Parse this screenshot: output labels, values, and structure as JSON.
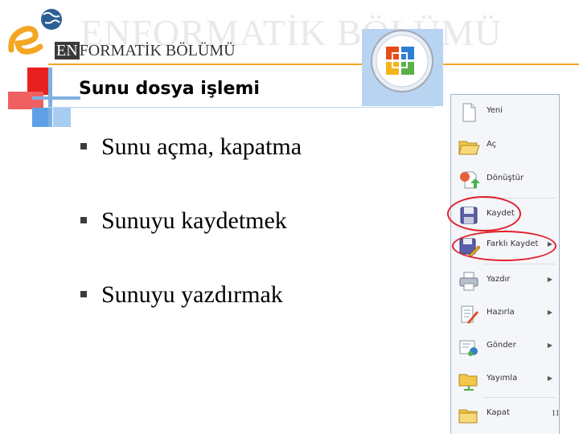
{
  "header": {
    "watermark": "ENFORMATİK BÖLÜMÜ",
    "brand_prefix": "EN",
    "brand_rest": "FORMATİK BÖLÜMÜ"
  },
  "slide": {
    "title": "Sunu dosya işlemi",
    "bullets": [
      "Sunu açma, kapatma",
      "Sunuyu kaydetmek",
      "Sunuyu yazdırmak"
    ],
    "page_number": "11"
  },
  "office_menu": {
    "items": [
      {
        "label": "Yeni",
        "icon": "new-document-icon",
        "submenu": false
      },
      {
        "label": "Aç",
        "icon": "open-folder-icon",
        "submenu": false
      },
      {
        "label": "Dönüştür",
        "icon": "convert-icon",
        "submenu": false
      },
      {
        "label": "Kaydet",
        "icon": "save-icon",
        "submenu": false,
        "highlighted": true
      },
      {
        "label": "Farklı Kaydet",
        "icon": "save-as-icon",
        "submenu": true,
        "highlighted": true
      },
      {
        "label": "Yazdır",
        "icon": "printer-icon",
        "submenu": true
      },
      {
        "label": "Hazırla",
        "icon": "prepare-icon",
        "submenu": true
      },
      {
        "label": "Gönder",
        "icon": "send-icon",
        "submenu": true
      },
      {
        "label": "Yayımla",
        "icon": "publish-icon",
        "submenu": true
      },
      {
        "label": "Kapat",
        "icon": "close-folder-icon",
        "submenu": false
      }
    ]
  },
  "colors": {
    "accent_orange": "#f5a623",
    "highlight_red": "#e0202a",
    "menu_border": "#9eb6cf",
    "office_button_bg": "#b9d4f0"
  }
}
